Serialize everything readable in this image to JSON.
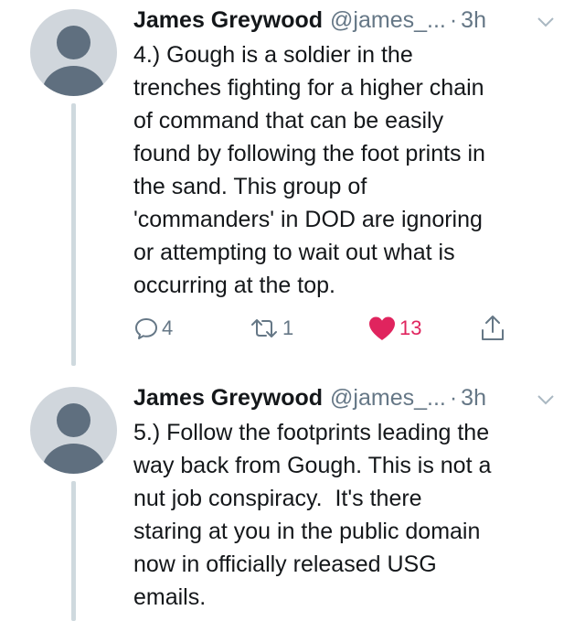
{
  "tweets": [
    {
      "author_name": "James Greywood",
      "handle": "@james_...",
      "separator": "·",
      "time": "3h",
      "text": "4.) Gough is a soldier in the\ntrenches fighting for a higher chain\nof command that can be easily\nfound by following the foot prints in\nthe sand. This group of\n'commanders' in DOD are ignoring\nor attempting to wait out what is\noccurring at the top.",
      "replies": "4",
      "retweets": "1",
      "likes": "13",
      "liked": true
    },
    {
      "author_name": "James Greywood",
      "handle": "@james_...",
      "separator": "·",
      "time": "3h",
      "text": "5.) Follow the footprints leading the\nway back from Gough. This is not a\nnut job conspiracy.  It's there\nstaring at you in the public domain\nnow in officially released USG\nemails."
    }
  ],
  "colors": {
    "like_active": "#e0245e",
    "meta": "#657786",
    "text": "#14171a",
    "thread_line": "#cfd9de",
    "avatar_bg": "#d0d6dc",
    "avatar_fg": "#5f6f7f"
  }
}
